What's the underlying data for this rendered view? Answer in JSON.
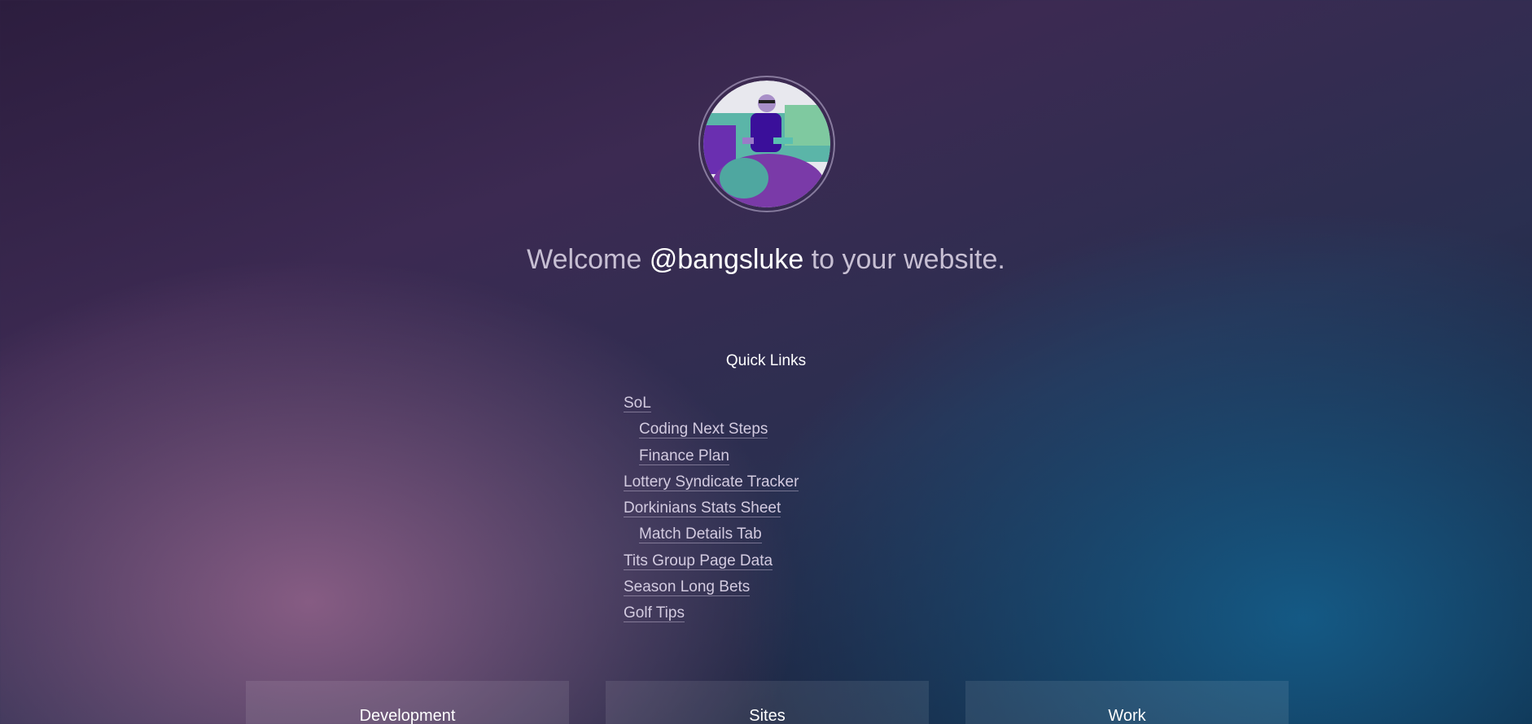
{
  "profile": {
    "welcome_prefix": "Welcome",
    "handle": "@bangsluke",
    "welcome_suffix": "to your website."
  },
  "quick_links": {
    "title": "Quick Links",
    "items": [
      {
        "label": "SoL",
        "indent": false
      },
      {
        "label": "Coding Next Steps",
        "indent": true
      },
      {
        "label": "Finance Plan",
        "indent": true
      },
      {
        "label": "Lottery Syndicate Tracker",
        "indent": false
      },
      {
        "label": "Dorkinians Stats Sheet",
        "indent": false
      },
      {
        "label": "Match Details Tab",
        "indent": true
      },
      {
        "label": "Tits Group Page Data",
        "indent": false
      },
      {
        "label": "Season Long Bets",
        "indent": false
      },
      {
        "label": "Golf Tips",
        "indent": false
      }
    ]
  },
  "cards": [
    {
      "title": "Development"
    },
    {
      "title": "Sites"
    },
    {
      "title": "Work"
    }
  ]
}
